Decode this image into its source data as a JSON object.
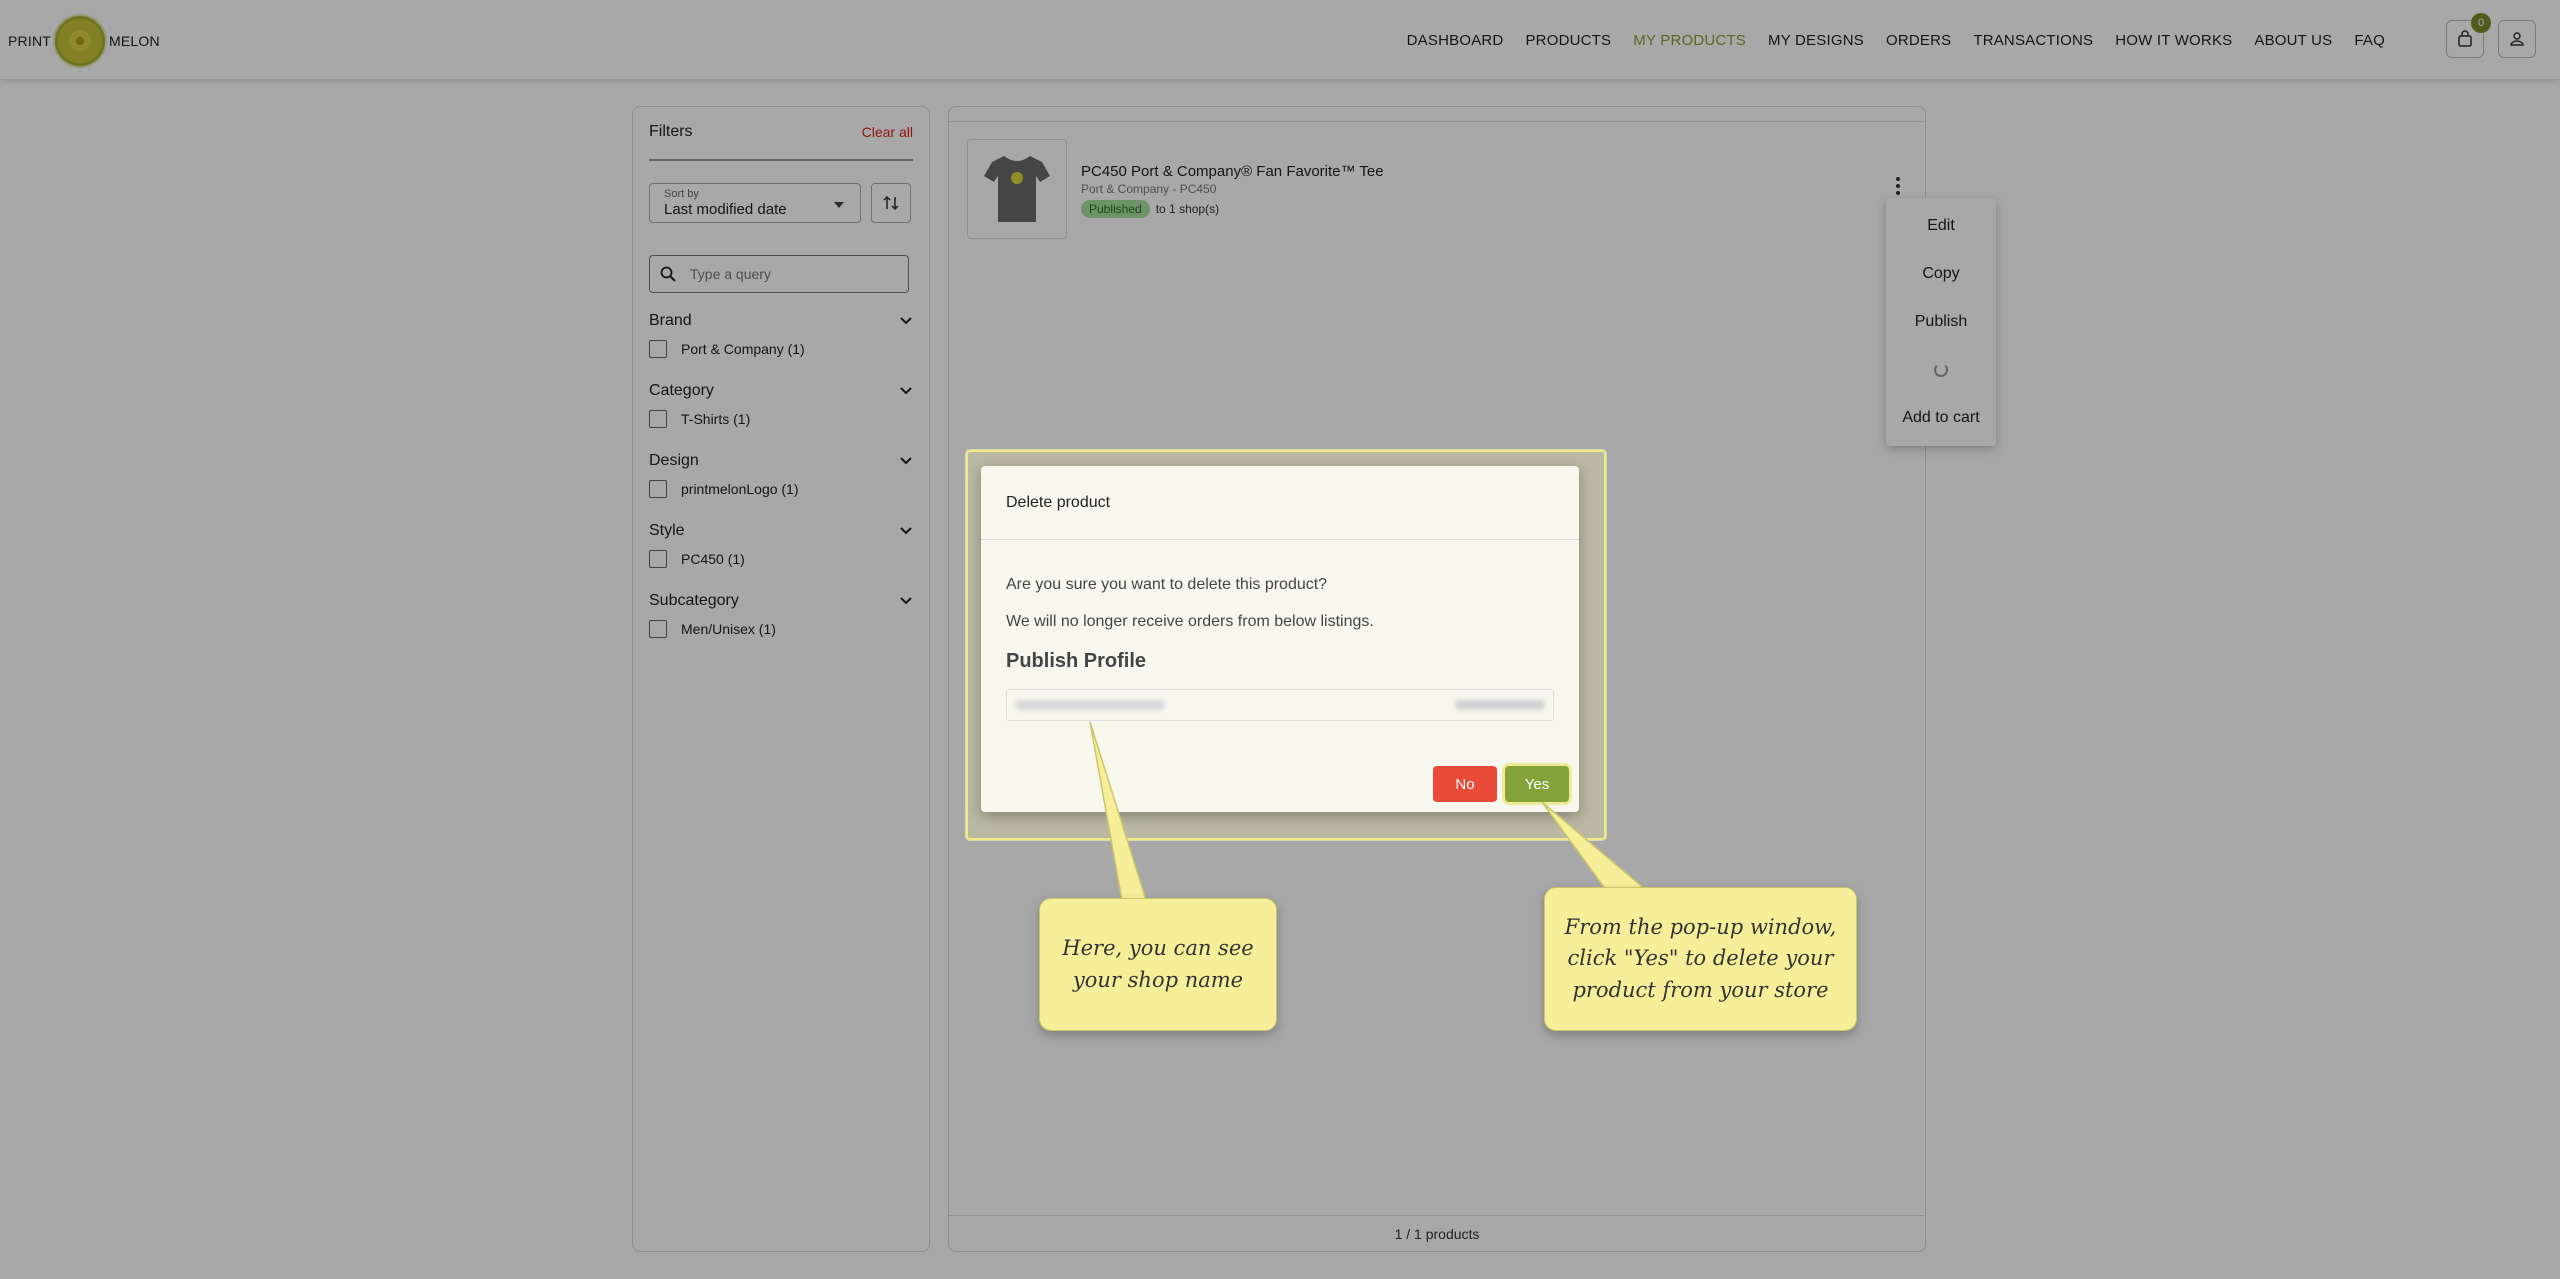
{
  "header": {
    "logo_left": "PRINT",
    "logo_right": "MELON",
    "nav": [
      {
        "label": "DASHBOARD",
        "active": false
      },
      {
        "label": "PRODUCTS",
        "active": false
      },
      {
        "label": "MY PRODUCTS",
        "active": true
      },
      {
        "label": "MY DESIGNS",
        "active": false
      },
      {
        "label": "ORDERS",
        "active": false
      },
      {
        "label": "TRANSACTIONS",
        "active": false
      },
      {
        "label": "HOW IT WORKS",
        "active": false
      },
      {
        "label": "ABOUT US",
        "active": false
      },
      {
        "label": "FAQ",
        "active": false
      }
    ],
    "cart_count": "0",
    "accent_color": "#86a232"
  },
  "filters": {
    "title": "Filters",
    "clear_all": "Clear all",
    "sort_label": "Sort by",
    "sort_value": "Last modified date",
    "search_placeholder": "Type a query",
    "facets": [
      {
        "title": "Brand",
        "items": [
          "Port & Company (1)"
        ]
      },
      {
        "title": "Category",
        "items": [
          "T-Shirts (1)"
        ]
      },
      {
        "title": "Design",
        "items": [
          "printmelonLogo (1)"
        ]
      },
      {
        "title": "Style",
        "items": [
          "PC450 (1)"
        ]
      },
      {
        "title": "Subcategory",
        "items": [
          "Men/Unisex (1)"
        ]
      }
    ]
  },
  "product": {
    "title": "PC450 Port & Company® Fan Favorite™ Tee",
    "subtitle": "Port & Company - PC450",
    "status_badge": "Published",
    "status_text": "to 1 shop(s)"
  },
  "pagination": "1 / 1 products",
  "menu": {
    "items": [
      "Edit",
      "Copy",
      "Publish",
      "Add to cart"
    ]
  },
  "modal": {
    "title": "Delete product",
    "line1": "Are you sure you want to delete this product?",
    "line2": "We will no longer receive orders from below listings.",
    "section": "Publish Profile",
    "no_label": "No",
    "yes_label": "Yes"
  },
  "callouts": {
    "shop_name": "Here, you can see your shop name",
    "yes_hint": "From the pop-up window, click \"Yes\" to delete your product from your store"
  }
}
